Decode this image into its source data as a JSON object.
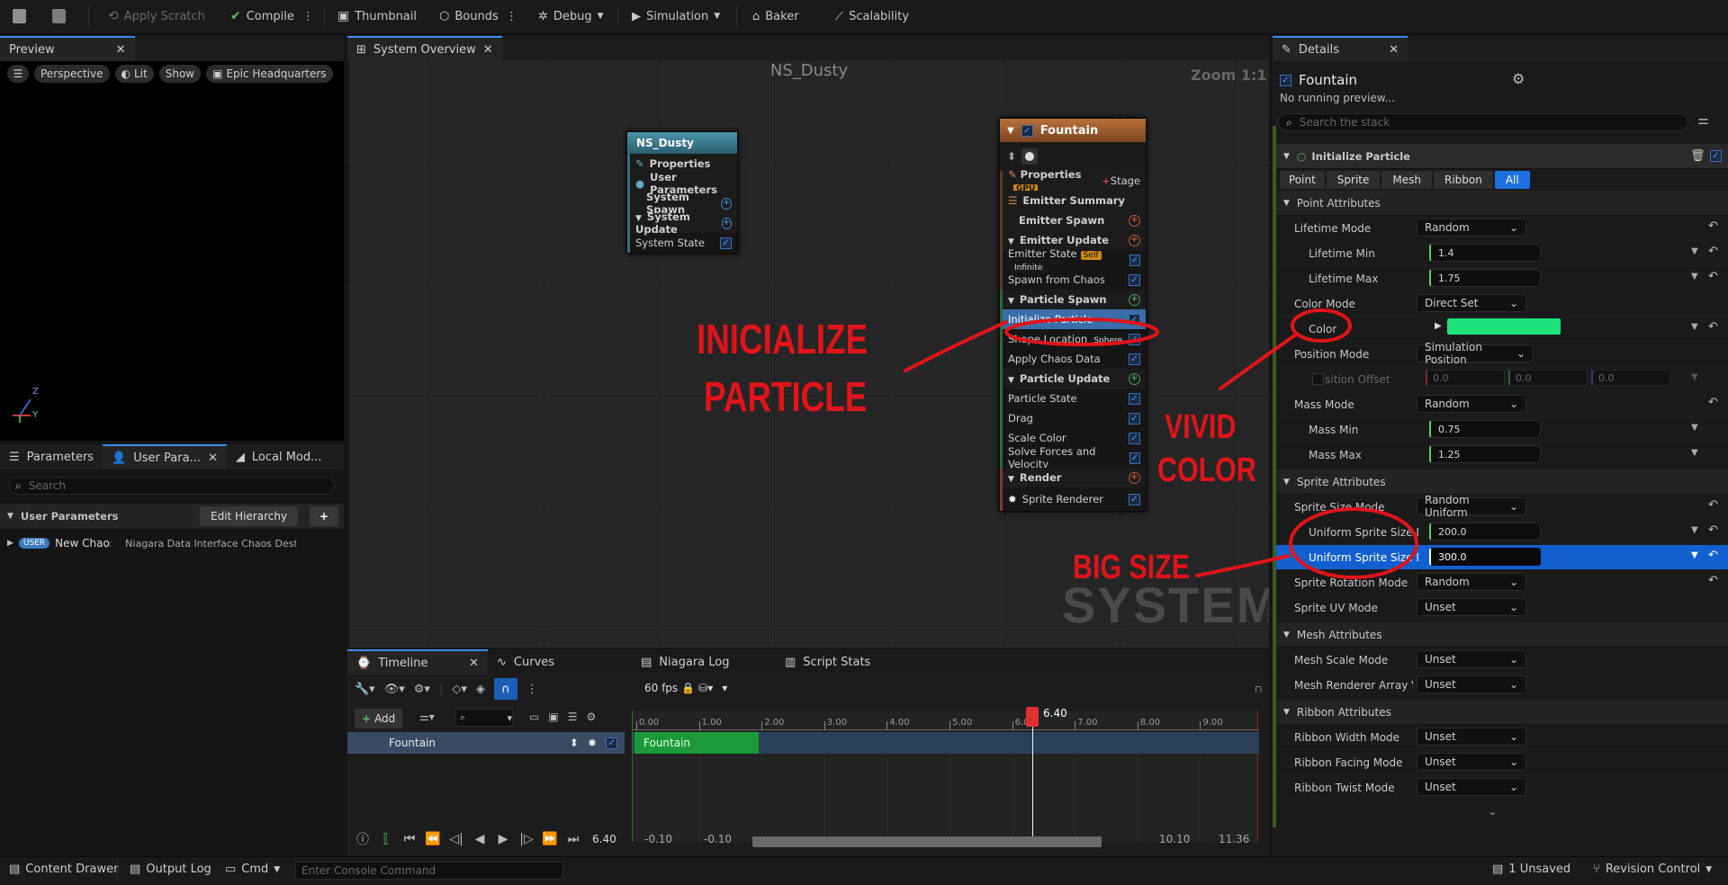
{
  "toolbar": {
    "apply_scratch": "Apply Scratch",
    "compile": "Compile",
    "thumbnail": "Thumbnail",
    "bounds": "Bounds",
    "debug": "Debug",
    "simulation": "Simulation",
    "baker": "Baker",
    "scalability": "Scalability"
  },
  "preview": {
    "tab": "Preview",
    "perspective": "Perspective",
    "lit": "Lit",
    "show": "Show",
    "location": "Epic Headquarters",
    "axis_z": "Z",
    "axis_y": "Y"
  },
  "params": {
    "tabs": [
      "Parameters",
      "User Para...",
      "Local Mod..."
    ],
    "search_placeholder": "Search",
    "section": "User Parameters",
    "edit_hierarchy": "Edit Hierarchy",
    "badge": "USER",
    "item_name": "New Chaos De",
    "item_type": "Niagara Data Interface Chaos Destruc"
  },
  "graph": {
    "tab": "System Overview",
    "title": "NS_Dusty",
    "zoom": "Zoom 1:1",
    "watermark": "SYSTEM",
    "system_node": {
      "title": "NS_Dusty",
      "rows": [
        "Properties",
        "User Parameters",
        "System Spawn",
        "System Update",
        "System State"
      ]
    },
    "emitter_node": {
      "title": "Fountain",
      "properties": "Properties",
      "gpu_tag": "GPU",
      "stage": "Stage",
      "emitter_summary": "Emitter Summary",
      "emitter_spawn": "Emitter Spawn",
      "emitter_update": "Emitter Update",
      "emitter_state": "Emitter State",
      "self_tag": "Self",
      "infinite_tag": "Infinite",
      "spawn_from_chaos": "Spawn from Chaos",
      "particle_spawn": "Particle Spawn",
      "initialize_particle": "Initialize Particle",
      "shape_location": "Shape Location",
      "sphere_tag": "Sphere",
      "apply_chaos_data": "Apply Chaos Data",
      "particle_update": "Particle Update",
      "particle_state": "Particle State",
      "drag": "Drag",
      "scale_color": "Scale Color",
      "solve_forces": "Solve Forces and Velocity",
      "render": "Render",
      "sprite_renderer": "Sprite Renderer"
    }
  },
  "annotations": {
    "init_line1": "INICIALIZE",
    "init_line2": "PARTICLE",
    "vivid_line1": "VIVID",
    "vivid_line2": "COLOR",
    "big_size": "BIG SIZE",
    "color_red": "#e0141a"
  },
  "timeline": {
    "tabs": [
      "Timeline",
      "Curves",
      "Niagara Log",
      "Script Stats"
    ],
    "fps": "60 fps",
    "add": "Add",
    "track": "Fountain",
    "bar_label": "Fountain",
    "playhead": "6.40",
    "ticks": [
      "0.00",
      "1.00",
      "2.00",
      "3.00",
      "4.00",
      "5.00",
      "6.00",
      "7.00",
      "8.00",
      "9.00"
    ],
    "time_display": "6.40",
    "range_start_a": "-0.10",
    "range_start_b": "-0.10",
    "range_end_a": "10.10",
    "range_end_b": "11.36"
  },
  "details": {
    "tab": "Details",
    "emitter": "Fountain",
    "status": "No running preview...",
    "search_placeholder": "Search the stack",
    "module": "Initialize Particle",
    "filters": [
      "Point",
      "Sprite",
      "Mesh",
      "Ribbon",
      "All"
    ],
    "point_attributes": "Point Attributes",
    "lifetime_mode": "Lifetime Mode",
    "lifetime_mode_value": "Random",
    "lifetime_min": "Lifetime Min",
    "lifetime_min_value": "1.4",
    "lifetime_max": "Lifetime Max",
    "lifetime_max_value": "1.75",
    "color_mode": "Color Mode",
    "color_mode_value": "Direct Set",
    "color": "Color",
    "color_swatch": "#1de27c",
    "position_mode": "Position Mode",
    "position_mode_value": "Simulation Position",
    "position_offset": "Position Offset",
    "offset_values": [
      "0.0",
      "0.0",
      "0.0"
    ],
    "mass_mode": "Mass Mode",
    "mass_mode_value": "Random",
    "mass_min": "Mass Min",
    "mass_min_value": "0.75",
    "mass_max": "Mass Max",
    "mass_max_value": "1.25",
    "sprite_attributes": "Sprite Attributes",
    "sprite_size_mode": "Sprite Size Mode",
    "sprite_size_mode_value": "Random Uniform",
    "uniform_min": "Uniform Sprite Size M",
    "uniform_min_value": "200.0",
    "uniform_max": "Uniform Sprite Size M",
    "uniform_max_value": "300.0",
    "sprite_rotation_mode": "Sprite Rotation Mode",
    "sprite_rotation_value": "Random",
    "sprite_uv_mode": "Sprite UV Mode",
    "sprite_uv_value": "Unset",
    "mesh_attributes": "Mesh Attributes",
    "mesh_scale_mode": "Mesh Scale Mode",
    "mesh_scale_value": "Unset",
    "mesh_renderer_array": "Mesh Renderer Array Vis",
    "mesh_renderer_value": "Unset",
    "ribbon_attributes": "Ribbon Attributes",
    "ribbon_width_mode": "Ribbon Width Mode",
    "ribbon_width_value": "Unset",
    "ribbon_facing_mode": "Ribbon Facing Mode",
    "ribbon_facing_value": "Unset",
    "ribbon_twist_mode": "Ribbon Twist Mode",
    "ribbon_twist_value": "Unset"
  },
  "statusbar": {
    "content_drawer": "Content Drawer",
    "output_log": "Output Log",
    "cmd": "Cmd",
    "console_placeholder": "Enter Console Command",
    "unsaved": "1 Unsaved",
    "revision_control": "Revision Control"
  }
}
